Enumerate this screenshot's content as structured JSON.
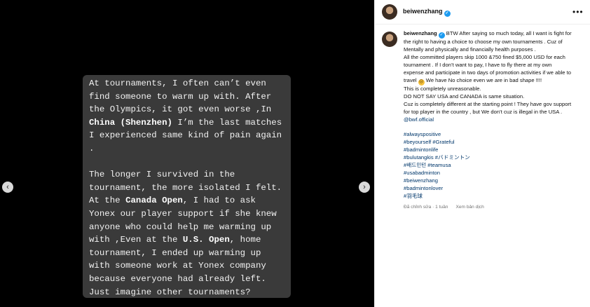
{
  "story": {
    "paragraph1": [
      {
        "t": "At tournaments, I often can’t even find someone to warm up with. After the Olympics, it got even worse ,In "
      },
      {
        "t": "China (Shenzhen)",
        "b": true
      },
      {
        "t": " I’m the last matches I experienced same kind of pain again ."
      }
    ],
    "paragraph2": [
      {
        "t": "The longer I survived in the tournament, the more isolated I felt. At the "
      },
      {
        "t": "Canada Open",
        "b": true
      },
      {
        "t": ", I had to ask Yonex our player support if she knew anyone who could help me warming up with ,Even at the "
      },
      {
        "t": "U.S. Open",
        "b": true
      },
      {
        "t": ", home tournament, I ended up warming up with someone work at Yonex company because everyone had already left. Just imagine other tournaments?"
      }
    ]
  },
  "carousel": {
    "prev_icon": "‹",
    "next_icon": "›"
  },
  "header": {
    "username": "beiwenzhang",
    "verified_icon": "✓",
    "more_icon": "•••"
  },
  "caption": {
    "username": "beiwenzhang",
    "intro": " BTW After saying so much today, all I want is fight for the right to having a choice to choose my own tournaments . Cuz of Mentally and physically and financially health purposes .",
    "line2a": "All the committed players skip 1000 &750 fined $5,000 USD for each tournament . If I don’t want to pay, I have to fly there at my own expense and participate in two days of promotion activities if we able to travel ",
    "emoji": "☹",
    "line2b": " We have No choice even we are in bad shape !!!!",
    "line3": "This is completely unreasonable.",
    "line4": "DO NOT SAY USA and CANADA is same situation.",
    "line5": "Cuz is completely different at the starting point ! They have gov support for top player in the country , but We don’t cuz is illegal in the USA .",
    "mention": "@bwf.official",
    "hashtags": [
      "#alwayspositive",
      "#beyourself #Grateful",
      "#badmintonlife",
      "#bulutangkis #バドミントン",
      "#배드민턴 #teamusa",
      "#usabadminton",
      "#beiwenzhang",
      "#badmintonlover",
      "#羽毛球"
    ],
    "edited": "Đã chỉnh sửa · 1 tuần",
    "translate": "Xem bản dịch"
  },
  "colors": {
    "link": "#00376b",
    "verified": "#1d9bf0",
    "note_bg": "#3a3a3a"
  }
}
